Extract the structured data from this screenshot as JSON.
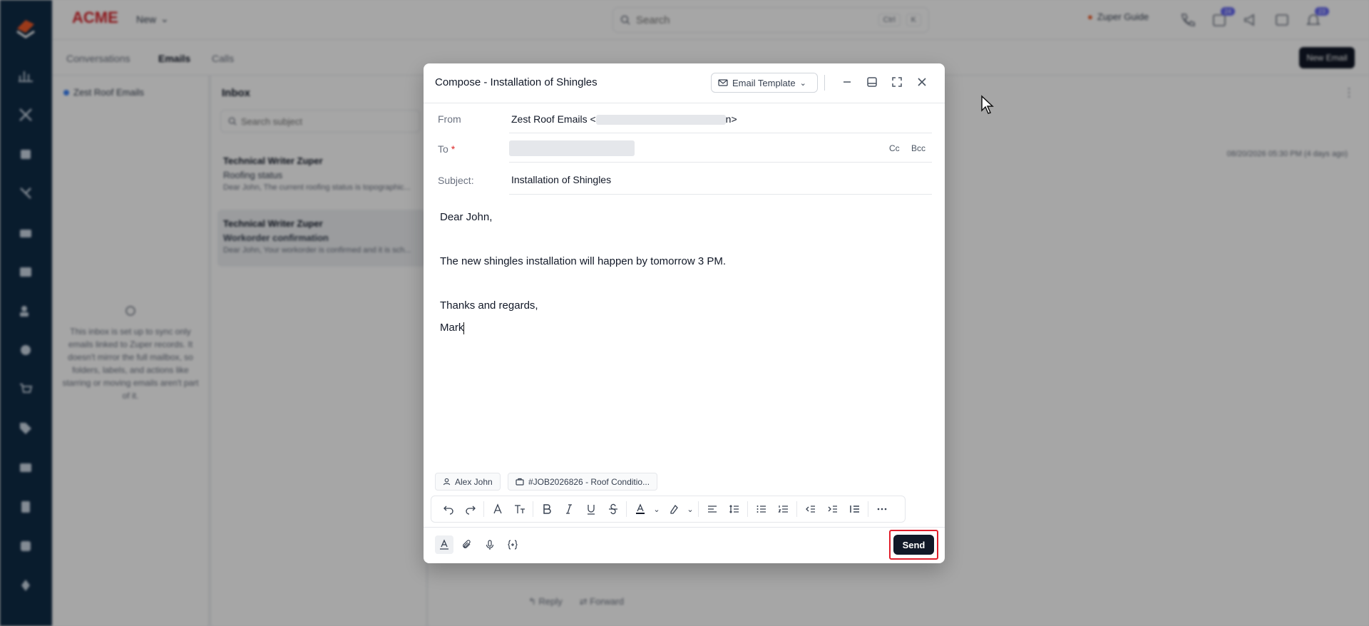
{
  "app": {
    "brand": "ACME",
    "new_label": "New",
    "search_placeholder": "Search",
    "search_keys": [
      "Ctrl",
      "K"
    ],
    "guide_label": "Zuper Guide",
    "badges": [
      "24",
      "23"
    ]
  },
  "tabs": [
    {
      "label": "Conversations",
      "active": false
    },
    {
      "label": "Emails",
      "active": true
    },
    {
      "label": "Calls",
      "active": false
    }
  ],
  "new_email_label": "New Email",
  "sidebar": {
    "account": "Zest Roof Emails",
    "sync_note": "This inbox is set up to sync only emails linked to Zuper records. It doesn't mirror the full mailbox, so folders, labels, and actions like starring or moving emails aren't part of it."
  },
  "inbox": {
    "title": "Inbox",
    "search_placeholder": "Search subject",
    "items": [
      {
        "sender": "Technical Writer Zuper",
        "subject": "Roofing status",
        "preview": "Dear John, The current roofing status is topographic..."
      },
      {
        "sender": "Technical Writer Zuper",
        "subject": "Workorder confirmation",
        "preview": "Dear John, Your workorder is confirmed and it is sch..."
      }
    ]
  },
  "pane": {
    "date": "08/20/2026 05:30 PM (4 days ago)",
    "reply_label": "Reply",
    "forward_label": "Forward"
  },
  "compose": {
    "title": "Compose - Installation of Shingles",
    "template_label": "Email Template",
    "from_label": "From",
    "from_name": "Zest Roof Emails <",
    "from_tail": "n>",
    "to_label": "To",
    "to_required": "*",
    "cc_label": "Cc",
    "bcc_label": "Bcc",
    "subject_label": "Subject:",
    "subject_value": "Installation of Shingles",
    "body_lines": [
      "Dear John,",
      "",
      "The new shingles installation will happen by tomorrow 3 PM.",
      "",
      "Thanks and regards,",
      "Mark"
    ],
    "chips": [
      "Alex John",
      "#JOB2026826 - Roof Conditio..."
    ],
    "send_label": "Send",
    "accent": "#e11d2a"
  }
}
